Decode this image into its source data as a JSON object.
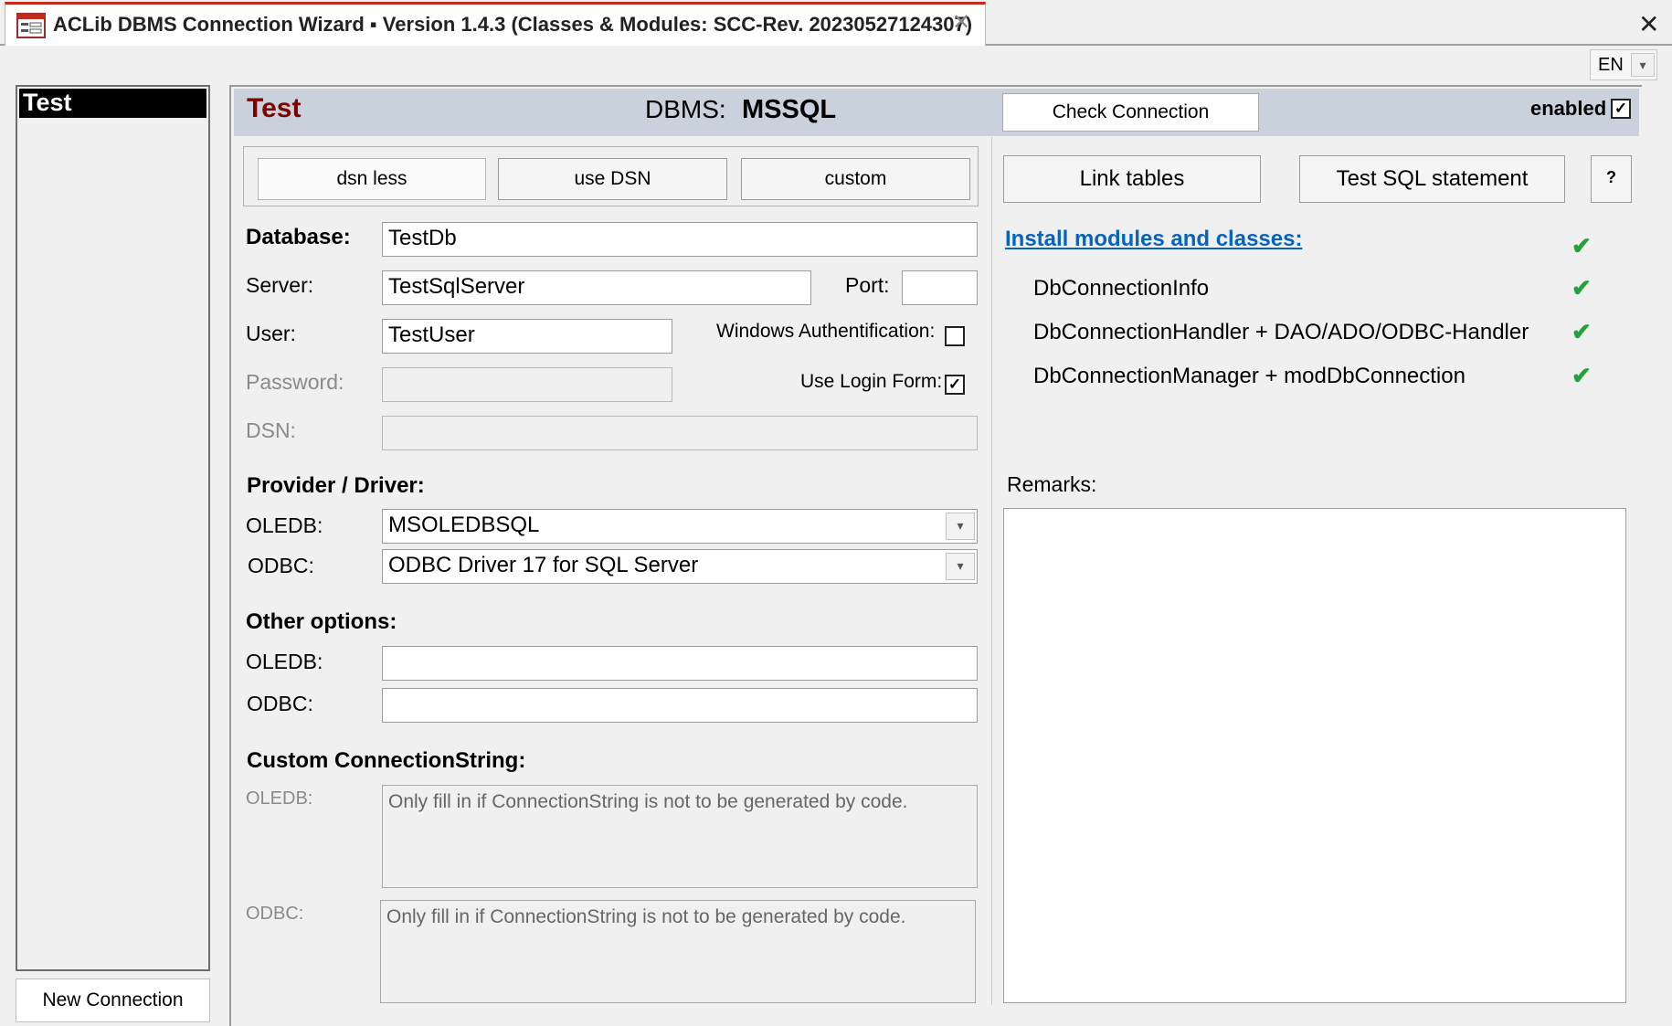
{
  "window": {
    "title": "ACLib DBMS Connection Wizard  ▪  Version 1.4.3 (Classes & Modules: SCC-Rev. 20230527124307)",
    "tab_close": "✕",
    "app_close": "✕",
    "language": "EN"
  },
  "sidebar": {
    "items": [
      {
        "label": "Test",
        "selected": true
      }
    ],
    "new_connection_label": "New Connection"
  },
  "header": {
    "connection_name": "Test",
    "dbms_label": "DBMS:",
    "dbms_value": "MSSQL",
    "check_connection_label": "Check Connection",
    "enabled_label": "enabled",
    "enabled_checked": "✓"
  },
  "mode_buttons": {
    "dsn_less": "dsn less",
    "use_dsn": "use DSN",
    "custom": "custom"
  },
  "form": {
    "database_label": "Database:",
    "database_value": "TestDb",
    "server_label": "Server:",
    "server_value": "TestSqlServer",
    "port_label": "Port:",
    "port_value": "",
    "user_label": "User:",
    "user_value": "TestUser",
    "windows_auth_label": "Windows Authentification:",
    "windows_auth_checked": "",
    "password_label": "Password:",
    "password_value": "",
    "use_login_form_label": "Use Login Form:",
    "use_login_form_checked": "✓",
    "dsn_label": "DSN:",
    "dsn_value": ""
  },
  "provider": {
    "section_title": "Provider / Driver:",
    "oledb_label": "OLEDB:",
    "oledb_value": "MSOLEDBSQL",
    "odbc_label": "ODBC:",
    "odbc_value": "ODBC Driver 17 for SQL Server"
  },
  "other_options": {
    "section_title": "Other options:",
    "oledb_label": "OLEDB:",
    "oledb_value": "",
    "odbc_label": "ODBC:",
    "odbc_value": ""
  },
  "custom_connection": {
    "section_title": "Custom ConnectionString:",
    "oledb_label": "OLEDB:",
    "oledb_placeholder": "Only fill in if ConnectionString is not to be generated by code.",
    "odbc_label": "ODBC:",
    "odbc_placeholder": "Only fill in if ConnectionString is not to be generated by code."
  },
  "actions": {
    "link_tables": "Link tables",
    "test_sql": "Test SQL statement",
    "help": "?"
  },
  "install": {
    "link_label": "Install modules and classes:",
    "modules": [
      {
        "name": "DbConnectionInfo",
        "status": "✔"
      },
      {
        "name": "DbConnectionHandler + DAO/ADO/ODBC-Handler",
        "status": "✔"
      },
      {
        "name": "DbConnectionManager + modDbConnection",
        "status": "✔"
      }
    ],
    "all_status": "✔"
  },
  "remarks": {
    "label": "Remarks:",
    "value": ""
  },
  "colors": {
    "accent_title": "#7f0000",
    "header_bg": "#c9d1dd",
    "link": "#0563c1",
    "tick": "#1fa33a",
    "tab_top": "#c42b1c"
  }
}
